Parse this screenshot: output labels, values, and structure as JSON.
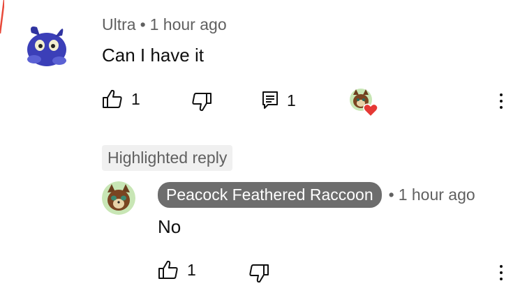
{
  "colors": {
    "accent": "#e8493a",
    "meta_text": "#606060",
    "text": "#0f0f0f",
    "pill_bg": "#6d6d6d",
    "badge_bg": "#f0f0f0",
    "heart": "#e53935"
  },
  "comment": {
    "author": "Ultra",
    "separator": "•",
    "time": "1 hour ago",
    "text": "Can I have it",
    "like_count": "1",
    "reply_count": "1",
    "icons": {
      "like": "thumbs-up-icon",
      "dislike": "thumbs-down-icon",
      "replies": "comment-icon",
      "more": "more-vert-icon",
      "creator_heart": "heart-icon"
    }
  },
  "reply": {
    "badge": "Highlighted reply",
    "author": "Peacock Feathered Raccoon",
    "separator": "•",
    "time": "1 hour ago",
    "text": "No",
    "like_count": "1"
  }
}
